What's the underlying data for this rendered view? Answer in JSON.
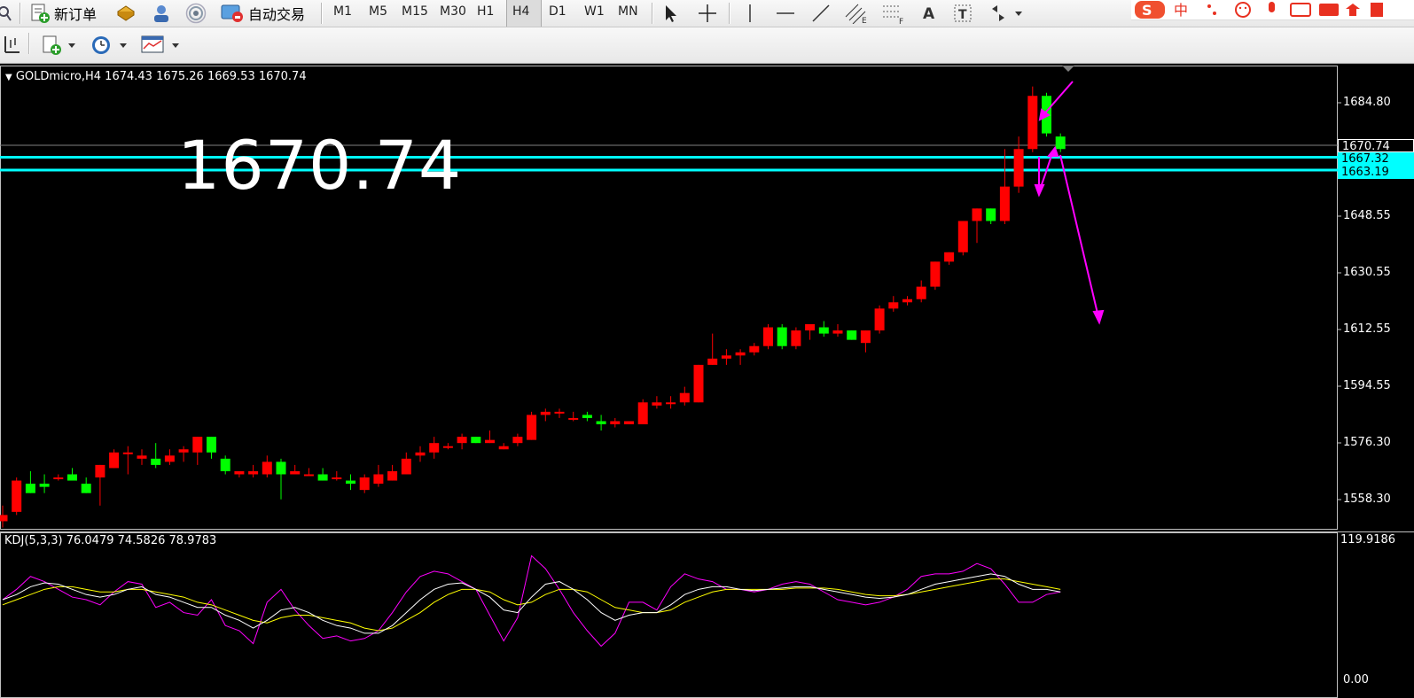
{
  "toolbar": {
    "new_order_label": "新订单",
    "auto_trade_label": "自动交易",
    "timeframes": [
      "M1",
      "M5",
      "M15",
      "M30",
      "H1",
      "H4",
      "D1",
      "W1",
      "MN"
    ],
    "active_timeframe": "H4",
    "ime_label": "中"
  },
  "chart": {
    "title": "GOLDmicro,H4",
    "ohlc": "1674.43 1675.26 1669.53 1670.74",
    "big_price": "1670.74",
    "current_price_label": "1670.74",
    "line1_label": "1667.32",
    "line2_label": "1663.19",
    "price_axis": [
      "1684.80",
      "1648.55",
      "1630.55",
      "1612.55",
      "1594.55",
      "1576.30",
      "1558.30"
    ],
    "indicator_title": "KDJ(5,3,3) 76.0479 74.5826 78.9783",
    "indicator_axis_top": "119.9186",
    "indicator_axis_bottom": "0.00",
    "colors": {
      "bull": "#00ff00",
      "bear": "#ff0000",
      "level_line": "#00ffff",
      "annotation": "#ff00ff",
      "k_line": "#ffffff",
      "d_line": "#ffff00",
      "j_line": "#ff00ff"
    }
  },
  "chart_data": {
    "type": "candlestick",
    "symbol": "GOLDmicro",
    "timeframe": "H4",
    "ohlc": [
      [
        1551,
        1556,
        1549,
        1553
      ],
      [
        1554,
        1565,
        1553,
        1564
      ],
      [
        1563,
        1567,
        1560,
        1560
      ],
      [
        1563,
        1566,
        1560,
        1562
      ],
      [
        1565,
        1566,
        1564,
        1565
      ],
      [
        1566,
        1568,
        1564,
        1564
      ],
      [
        1563,
        1565,
        1561,
        1560
      ],
      [
        1565,
        1568,
        1556,
        1569
      ],
      [
        1568,
        1574,
        1569,
        1573
      ],
      [
        1573,
        1575,
        1566,
        1573
      ],
      [
        1571,
        1574,
        1569,
        1572
      ],
      [
        1571,
        1576,
        1568,
        1569
      ],
      [
        1570,
        1574,
        1569,
        1572
      ],
      [
        1573,
        1575,
        1570,
        1574
      ],
      [
        1573,
        1578,
        1569,
        1578
      ],
      [
        1578,
        1578,
        1571,
        1573
      ],
      [
        1571,
        1572,
        1566,
        1567
      ],
      [
        1566,
        1567,
        1565,
        1567
      ],
      [
        1566,
        1569,
        1565,
        1567
      ],
      [
        1566,
        1572,
        1565,
        1570
      ],
      [
        1570,
        1571,
        1558,
        1566
      ],
      [
        1566,
        1569,
        1566,
        1567
      ],
      [
        1566,
        1568,
        1566,
        1566
      ],
      [
        1566,
        1568,
        1564,
        1564
      ],
      [
        1565,
        1567,
        1564,
        1565
      ],
      [
        1564,
        1566,
        1561,
        1563
      ],
      [
        1561,
        1566,
        1560,
        1565
      ],
      [
        1563,
        1569,
        1562,
        1566
      ],
      [
        1564,
        1569,
        1564,
        1567
      ],
      [
        1566,
        1573,
        1566,
        1571
      ],
      [
        1572,
        1575,
        1570,
        1573
      ],
      [
        1573,
        1578,
        1571,
        1576
      ],
      [
        1575,
        1576,
        1574,
        1575
      ],
      [
        1576,
        1579,
        1574,
        1578
      ],
      [
        1578,
        1578,
        1576,
        1576
      ],
      [
        1576,
        1580,
        1576,
        1577
      ],
      [
        1574,
        1576,
        1574,
        1575
      ],
      [
        1576,
        1579,
        1575,
        1578
      ],
      [
        1577,
        1586,
        1577,
        1585
      ],
      [
        1585,
        1587,
        1583,
        1586
      ],
      [
        1586,
        1587,
        1584,
        1586
      ],
      [
        1584,
        1586,
        1583,
        1584
      ],
      [
        1585,
        1586,
        1583,
        1584
      ],
      [
        1583,
        1585,
        1580,
        1582
      ],
      [
        1582,
        1584,
        1581,
        1583
      ],
      [
        1582,
        1583,
        1582,
        1583
      ],
      [
        1582,
        1590,
        1582,
        1589
      ],
      [
        1588,
        1591,
        1587,
        1589
      ],
      [
        1589,
        1591,
        1587,
        1589
      ],
      [
        1589,
        1594,
        1588,
        1592
      ],
      [
        1589,
        1601,
        1589,
        1601
      ],
      [
        1601,
        1611,
        1601,
        1603
      ],
      [
        1603,
        1606,
        1601,
        1604
      ],
      [
        1604,
        1606,
        1601,
        1605
      ],
      [
        1605,
        1608,
        1604,
        1607
      ],
      [
        1607,
        1614,
        1606,
        1613
      ],
      [
        1613,
        1614,
        1606,
        1607
      ],
      [
        1607,
        1613,
        1606,
        1612
      ],
      [
        1612,
        1614,
        1609,
        1614
      ],
      [
        1613,
        1615,
        1610,
        1611
      ],
      [
        1611,
        1614,
        1610,
        1612
      ],
      [
        1612,
        1612,
        1609,
        1609
      ],
      [
        1608,
        1611,
        1605,
        1612
      ],
      [
        1612,
        1620,
        1611,
        1619
      ],
      [
        1619,
        1623,
        1618,
        1621
      ],
      [
        1621,
        1623,
        1620,
        1622
      ],
      [
        1622,
        1628,
        1621,
        1626
      ],
      [
        1626,
        1634,
        1625,
        1634
      ],
      [
        1634,
        1637,
        1633,
        1637
      ],
      [
        1637,
        1646,
        1636,
        1647
      ],
      [
        1647,
        1649,
        1640,
        1651
      ],
      [
        1651,
        1650,
        1646,
        1647
      ],
      [
        1647,
        1670,
        1646,
        1658
      ],
      [
        1658,
        1674,
        1656,
        1670
      ],
      [
        1670,
        1690,
        1669,
        1687
      ],
      [
        1687,
        1688,
        1674,
        1675
      ],
      [
        1674,
        1675,
        1669,
        1670
      ]
    ]
  }
}
